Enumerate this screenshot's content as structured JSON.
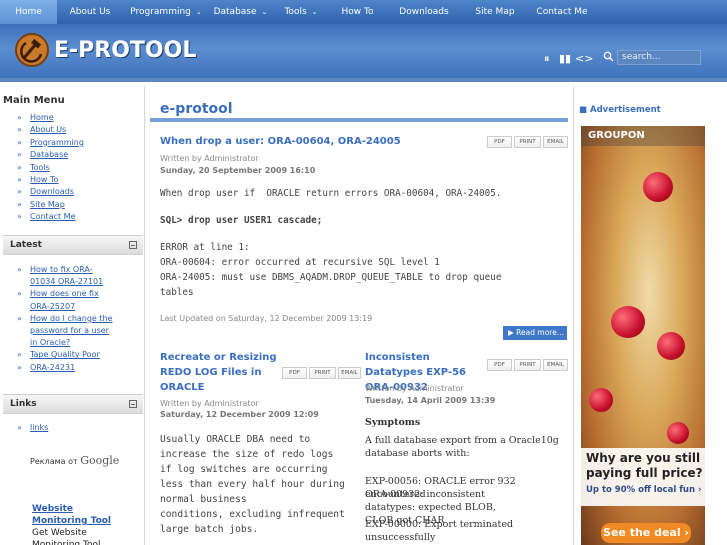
{
  "topnav": {
    "items": [
      {
        "label": "Home",
        "dropdown": false,
        "active": true
      },
      {
        "label": "About Us",
        "dropdown": false
      },
      {
        "label": "Programming",
        "dropdown": true
      },
      {
        "label": "Database",
        "dropdown": true
      },
      {
        "label": "Tools",
        "dropdown": true
      },
      {
        "label": "How To",
        "dropdown": false
      },
      {
        "label": "Downloads",
        "dropdown": false
      },
      {
        "label": "Site Map",
        "dropdown": false
      },
      {
        "label": "Contact Me",
        "dropdown": false
      }
    ],
    "caret": "⌄"
  },
  "header": {
    "logo_text": "E-PROTOOL",
    "controls": [
      "⏸",
      "▮▮",
      "<>"
    ],
    "search_placeholder": "search..."
  },
  "main_menu": {
    "title": "Main Menu",
    "items": [
      "Home",
      "About Us",
      "Programming",
      "Database",
      "Tools",
      "How To",
      "Downloads",
      "Site Map",
      "Contact Me"
    ]
  },
  "latest": {
    "title": "Latest",
    "items": [
      "How to fix ORA-01034 ORA-27101",
      "How does one fix ORA-25207",
      "How do I change the password for a user in Oracle?",
      "Tape Quality Poor",
      "ORA-24231"
    ]
  },
  "links": {
    "title": "Links",
    "items": [
      "links"
    ],
    "ads_by": "Реклама от",
    "google": "Google",
    "ad_link": "Website Monitoring Tool",
    "ad_text": "Get Website Monitoring Tool"
  },
  "main": {
    "title": "e-protool",
    "buttons": [
      "PDF",
      "PRINT",
      "EMAIL"
    ],
    "read_more": "Read more...",
    "article1": {
      "title": "When drop a user: ORA-00604, ORA-24005",
      "author": "Written by Administrator",
      "date": "Sunday, 20 September 2009 16:10",
      "body": [
        "When drop user if  ORACLE return errors ORA-00604, ORA-24005.",
        "",
        "SQL> drop user USER1 cascade;",
        "",
        "ERROR at line 1:",
        "ORA-00604: error occurred at recursive SQL level 1",
        "ORA-24005: must use DBMS_AQADM.DROP_QUEUE_TABLE to drop queue",
        "tables"
      ],
      "updated": "Last Updated on Saturday, 12 December 2009 13:19"
    },
    "article2": {
      "title": "Recreate or Resizing REDO LOG Files in ORACLE",
      "author": "Written by Administrator",
      "date": "Saturday, 12 December 2009 12:09",
      "body": [
        "Usually ORACLE DBA need to",
        "increase the size of redo logs",
        "if log switches are occurring",
        "less than every half hour during",
        "normal business",
        "conditions, excluding infrequent",
        "large batch jobs."
      ]
    },
    "article3": {
      "title": "Inconsisten Datatypes EXP-56 ORA-00932",
      "author": "Written by Administrator",
      "date": "Tuesday, 14 April 2009 13:39",
      "symptoms": "Symptoms",
      "body": "A full database export from a Oracle10g database aborts with:",
      "body2": [
        "EXP-00056: ORACLE error 932 encountered",
        "ORA-00932: inconsistent datatypes: expected BLOB, CLOB got CHAR",
        "EXP-00000: Export terminated unsuccessfully"
      ]
    }
  },
  "advert": {
    "title": "Advertisement",
    "brand": "GROUPON",
    "headline": "Why are you still paying full price?",
    "subline": "Up to 90% off local fun ›",
    "cta": "See the deal ›"
  }
}
